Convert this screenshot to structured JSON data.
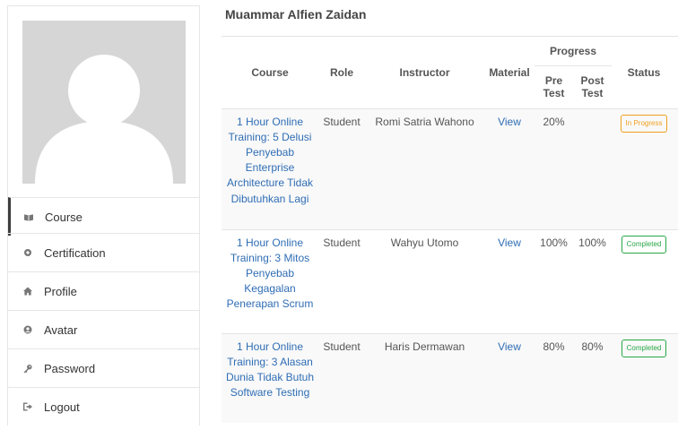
{
  "sidebar": {
    "menu": [
      {
        "label": "Course",
        "icon": "book-icon"
      },
      {
        "label": "Certification",
        "icon": "certificate-icon"
      },
      {
        "label": "Profile",
        "icon": "home-icon"
      },
      {
        "label": "Avatar",
        "icon": "user-circle-icon"
      },
      {
        "label": "Password",
        "icon": "key-icon"
      },
      {
        "label": "Logout",
        "icon": "logout-icon"
      }
    ]
  },
  "main": {
    "username": "Muammar Alfien Zaidan",
    "table": {
      "headers": {
        "course": "Course",
        "role": "Role",
        "instructor": "Instructor",
        "material": "Material",
        "progress": "Progress",
        "pre_test": "Pre Test",
        "post_test": "Post Test",
        "status": "Status"
      },
      "rows": [
        {
          "course": "1 Hour Online Training: 5 Delusi Penyebab Enterprise Architecture Tidak Dibutuhkan Lagi",
          "role": "Student",
          "instructor": "Romi Satria Wahono",
          "material": "View",
          "pre": "20%",
          "post": "",
          "status": "In Progress"
        },
        {
          "course": "1 Hour Online Training: 3 Mitos Penyebab Kegagalan Penerapan Scrum",
          "role": "Student",
          "instructor": "Wahyu Utomo",
          "material": "View",
          "pre": "100%",
          "post": "100%",
          "status": "Completed"
        },
        {
          "course": "1 Hour Online Training: 3 Alasan Dunia Tidak Butuh Software Testing",
          "role": "Student",
          "instructor": "Haris Dermawan",
          "material": "View",
          "pre": "80%",
          "post": "80%",
          "status": "Completed"
        }
      ]
    }
  }
}
